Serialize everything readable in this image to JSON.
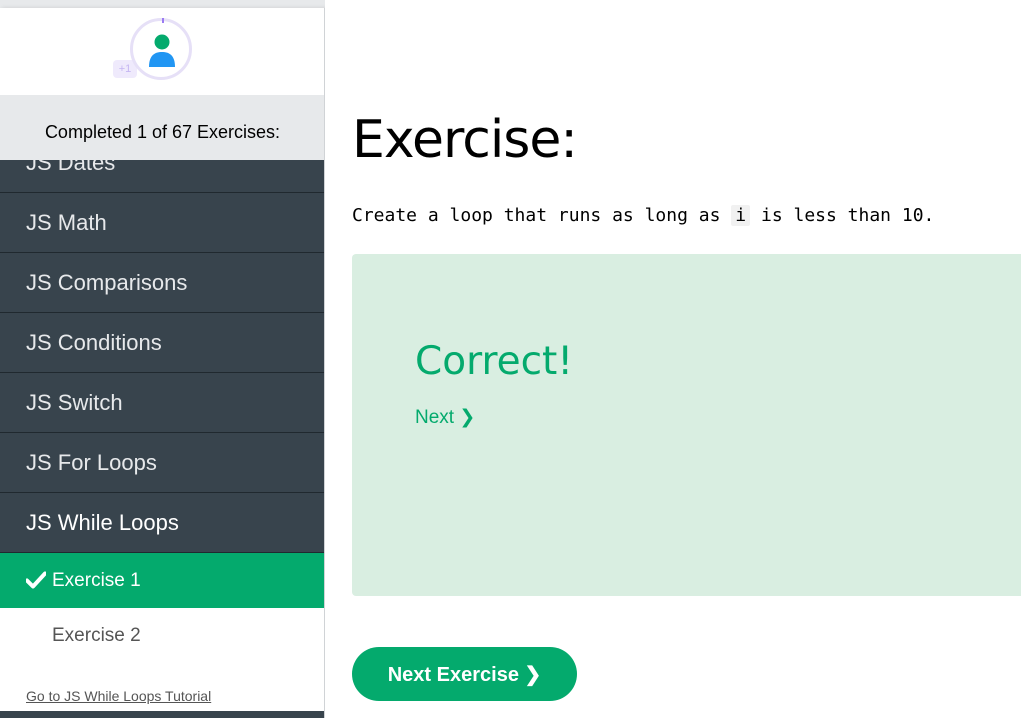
{
  "sidebar": {
    "xp_badge": "+1",
    "progress_text": "Completed 1 of 67 Exercises:",
    "nav_items": [
      {
        "label": "JS Dates"
      },
      {
        "label": "JS Math"
      },
      {
        "label": "JS Comparisons"
      },
      {
        "label": "JS Conditions"
      },
      {
        "label": "JS Switch"
      },
      {
        "label": "JS For Loops"
      },
      {
        "label": "JS While Loops",
        "active": true
      }
    ],
    "exercises": [
      {
        "label": "Exercise 1",
        "completed": true
      },
      {
        "label": "Exercise 2",
        "completed": false
      }
    ],
    "tutorial_link": "Go to JS While Loops Tutorial"
  },
  "main": {
    "heading": "Exercise:",
    "instruction_parts": [
      "Create a loop that runs as long as ",
      "i",
      " is less than ",
      "10",
      "."
    ],
    "result_title": "Correct!",
    "next_link": "Next ❯",
    "next_exercise_button": "Next Exercise ❯"
  },
  "icons": {
    "avatar": "user-avatar-icon",
    "check": "check-icon"
  },
  "colors": {
    "accent": "#04aa6d",
    "sidebar_bg": "#38444d",
    "result_bg": "#d9eee1"
  }
}
